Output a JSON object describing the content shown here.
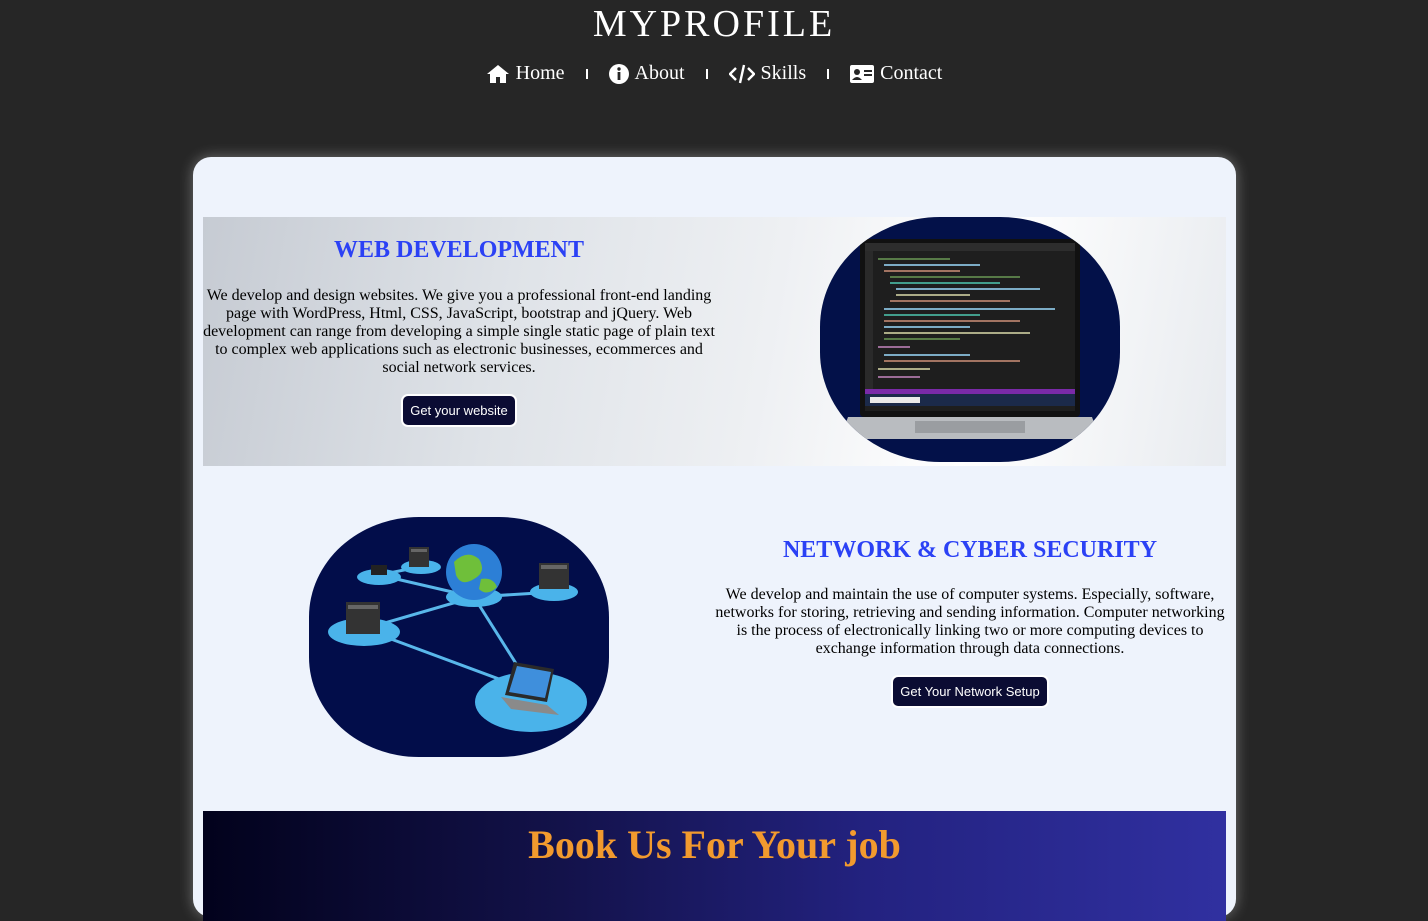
{
  "header": {
    "title": "MYPROFILE",
    "nav": [
      {
        "label": "Home",
        "icon": "home-icon"
      },
      {
        "label": "About",
        "icon": "info-icon"
      },
      {
        "label": "Skills",
        "icon": "code-icon"
      },
      {
        "label": "Contact",
        "icon": "contact-card-icon"
      }
    ]
  },
  "web_dev": {
    "title": "WEB DEVELOPMENT",
    "text": "We develop and design websites. We give you a professional front-end landing page with WordPress, Html, CSS, JavaScript, bootstrap and jQuery. Web development can range from developing a simple single static page of plain text to complex web applications such as electronic businesses, ecommerces and social network services.",
    "button": "Get your website"
  },
  "network": {
    "title": "NETWORK & CYBER SECURITY",
    "text": "We develop and maintain the use of computer systems. Especially, software, networks for storing, retrieving and sending information. Computer networking is the process of electronically linking two or more computing devices to exchange information through data connections.",
    "button": "Get Your Network Setup"
  },
  "book": {
    "title": "Book Us For Your job"
  },
  "colors": {
    "page_bg": "#262626",
    "card_bg": "#eef3fc",
    "section_title": "#2b41f5",
    "button_bg": "#0b0c33",
    "book_title": "#f29a2e",
    "image_blob": "#031149"
  }
}
